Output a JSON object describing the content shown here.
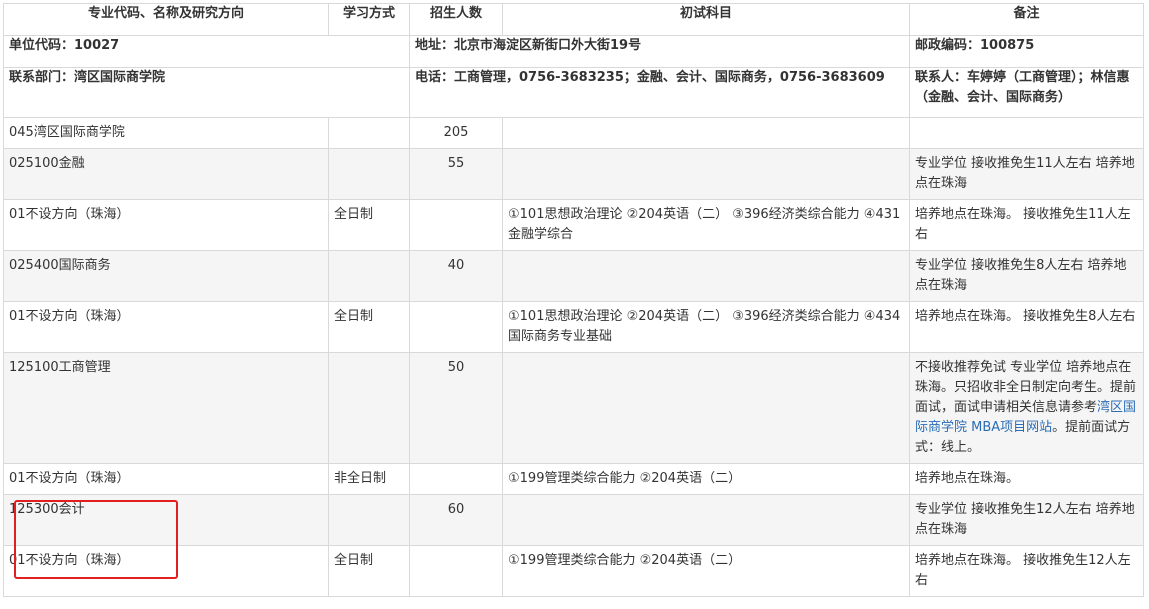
{
  "header": {
    "unit_code": "单位代码：10027",
    "address": "地址：北京市海淀区新街口外大街19号",
    "postcode": "邮政编码：100875",
    "department": "联系部门：湾区国际商学院",
    "phone": "电话：工商管理，0756-3683235；金融、会计、国际商务，0756-3683609",
    "contact": "联系人：车婷婷（工商管理）；林信惠（金融、会计、国际商务）"
  },
  "columns": [
    "专业代码、名称及研究方向",
    "学习方式",
    "招生人数",
    "初试科目",
    "备注"
  ],
  "rows": {
    "college": {
      "name": "045湾区国际商学院",
      "count": "205"
    },
    "finance": {
      "name": "025100金融",
      "count": "55",
      "note": "专业学位 接收推免生11人左右 培养地点在珠海",
      "dir": {
        "name": "01不设方向（珠海）",
        "mode": "全日制",
        "exam": "①101思想政治理论 ②204英语（二） ③396经济类综合能力 ④431金融学综合",
        "note": "培养地点在珠海。 接收推免生11人左右"
      }
    },
    "intl": {
      "name": "025400国际商务",
      "count": "40",
      "note": "专业学位 接收推免生8人左右 培养地点在珠海",
      "dir": {
        "name": "01不设方向（珠海）",
        "mode": "全日制",
        "exam": "①101思想政治理论 ②204英语（二） ③396经济类综合能力 ④434国际商务专业基础",
        "note": "培养地点在珠海。 接收推免生8人左右"
      }
    },
    "mba": {
      "name": "125100工商管理",
      "count": "50",
      "note_before": "不接收推荐免试 专业学位 培养地点在珠海。只招收非全日制定向考生。提前面试，面试申请相关信息请参考",
      "note_link": "湾区国际商学院 MBA项目网站",
      "note_after": "。提前面试方式：线上。",
      "dir": {
        "name": "01不设方向（珠海）",
        "mode": "非全日制",
        "exam": "①199管理类综合能力 ②204英语（二）",
        "note": "培养地点在珠海。"
      }
    },
    "accounting": {
      "name": "125300会计",
      "count": "60",
      "note": "专业学位 接收推免生12人左右 培养地点在珠海",
      "dir": {
        "name": "01不设方向（珠海）",
        "mode": "全日制",
        "exam": "①199管理类综合能力 ②204英语（二）",
        "note": "培养地点在珠海。 接收推免生12人左右"
      }
    }
  },
  "colors": {
    "border": "#d9d9d9",
    "row_gray": "#f5f5f5",
    "link": "#2a6db5",
    "highlight": "#e02020"
  }
}
